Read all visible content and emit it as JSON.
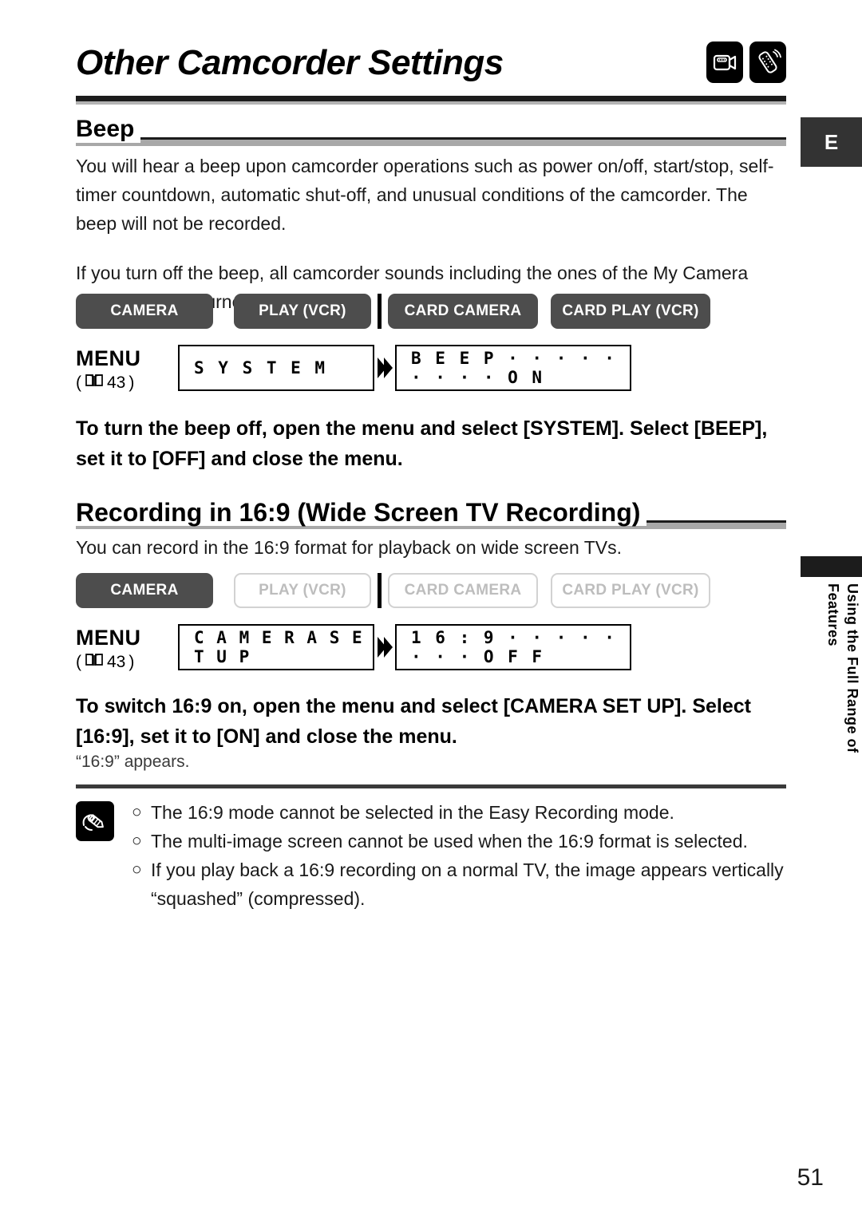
{
  "header": {
    "title": "Other Camcorder Settings",
    "icons": [
      "camcorder-icon",
      "remote-control-icon"
    ]
  },
  "language_tab": {
    "label": "E"
  },
  "side_tab": {
    "label": "Using the Full Range of Features"
  },
  "mode_labels": {
    "camera": "CAMERA",
    "play_vcr": "PLAY (VCR)",
    "card_camera": "CARD CAMERA",
    "card_play_vcr": "CARD PLAY (VCR)"
  },
  "menu": {
    "word": "MENU",
    "ref_open": "(",
    "ref_page": "43",
    "ref_close": ")"
  },
  "sections": [
    {
      "heading": "Beep",
      "paragraphs": [
        "You will hear a beep upon camcorder operations such as power on/off, start/stop, self-timer countdown, automatic shut-off, and unusual conditions of the camcorder. The beep will not be recorded.",
        "If you turn off the beep, all camcorder sounds including the ones of the My Camera settings will be turned off."
      ],
      "modes": {
        "camera": "on",
        "play_vcr": "on",
        "card_camera": "on",
        "card_play_vcr": "on"
      },
      "menu_path": {
        "category": "S Y S T E M",
        "setting": "B E E P · · · · · · · · · O N"
      },
      "instruction": "To turn the beep off, open the menu and select [SYSTEM]. Select [BEEP], set it to [OFF] and close the menu."
    },
    {
      "heading": "Recording in 16:9 (Wide Screen TV Recording)",
      "paragraphs": [
        "You can record in the 16:9 format for playback on wide screen TVs."
      ],
      "modes": {
        "camera": "on",
        "play_vcr": "off",
        "card_camera": "off",
        "card_play_vcr": "off"
      },
      "menu_path": {
        "category": "C A M E R A   S E T   U P",
        "setting": "1 6 : 9 · · · · · · · · O F F"
      },
      "instruction": "To switch 16:9 on, open the menu and select [CAMERA SET UP]. Select [16:9], set it to [ON] and close the menu.",
      "sub_note": "“16:9” appears."
    }
  ],
  "notes": {
    "icon": "memo-pencil-icon",
    "bullet": "○",
    "items": [
      "The 16:9 mode cannot be selected in the Easy Recording mode.",
      "The multi-image screen cannot be used when the 16:9 format is selected.",
      "If you play back a 16:9 recording on a normal TV, the image appears vertically"
    ],
    "continuation": "“squashed” (compressed)."
  },
  "page_number": "51"
}
